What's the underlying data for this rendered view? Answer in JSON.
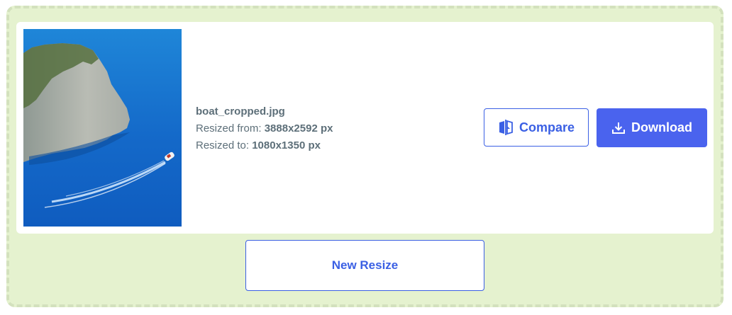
{
  "result": {
    "image": {
      "alt": "boat_cropped.jpg"
    },
    "filename": "boat_cropped.jpg",
    "resized_from_label": "Resized from:",
    "resized_from_value": "3888x2592 px",
    "resized_to_label": "Resized to:",
    "resized_to_value": "1080x1350 px"
  },
  "actions": {
    "compare_label": "Compare",
    "download_label": "Download",
    "new_resize_label": "New Resize"
  },
  "icons": {
    "compare": "compare-icon",
    "download": "download-icon"
  },
  "colors": {
    "dropzone_bg": "#e5f2cf",
    "dropzone_border": "#d3e1bd",
    "accent": "#3b60e4",
    "download_bg": "#4a63ee",
    "text": "#5d6f79"
  }
}
